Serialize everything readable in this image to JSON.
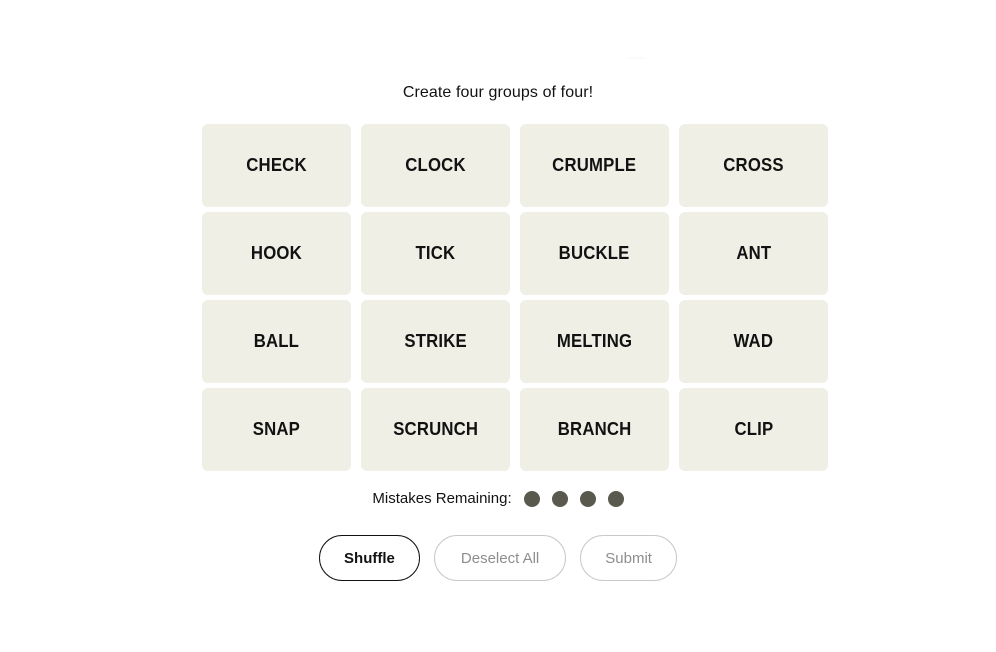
{
  "game": {
    "headline": "Create four groups of four!",
    "tile_bg_color": "#efefe6",
    "tile_text_color": "#121212",
    "dot_color": "#5a594e",
    "accent_color": "#121212",
    "muted_color": "#8e8e8e",
    "page_bg_color": "#ffffff"
  },
  "board": {
    "rows": 4,
    "columns": 4,
    "tiles": [
      {
        "label": "CHECK"
      },
      {
        "label": "CLOCK"
      },
      {
        "label": "CRUMPLE"
      },
      {
        "label": "CROSS"
      },
      {
        "label": "HOOK"
      },
      {
        "label": "TICK"
      },
      {
        "label": "BUCKLE"
      },
      {
        "label": "ANT"
      },
      {
        "label": "BALL"
      },
      {
        "label": "STRIKE"
      },
      {
        "label": "MELTING"
      },
      {
        "label": "WAD"
      },
      {
        "label": "SNAP"
      },
      {
        "label": "SCRUNCH"
      },
      {
        "label": "BRANCH"
      },
      {
        "label": "CLIP"
      }
    ]
  },
  "mistakes": {
    "label": "Mistakes Remaining:",
    "remaining": 4,
    "dots": [
      {
        "state": "filled"
      },
      {
        "state": "filled"
      },
      {
        "state": "filled"
      },
      {
        "state": "filled"
      }
    ]
  },
  "controls": {
    "shuffle_label": "Shuffle",
    "deselect_label": "Deselect All",
    "submit_label": "Submit"
  }
}
